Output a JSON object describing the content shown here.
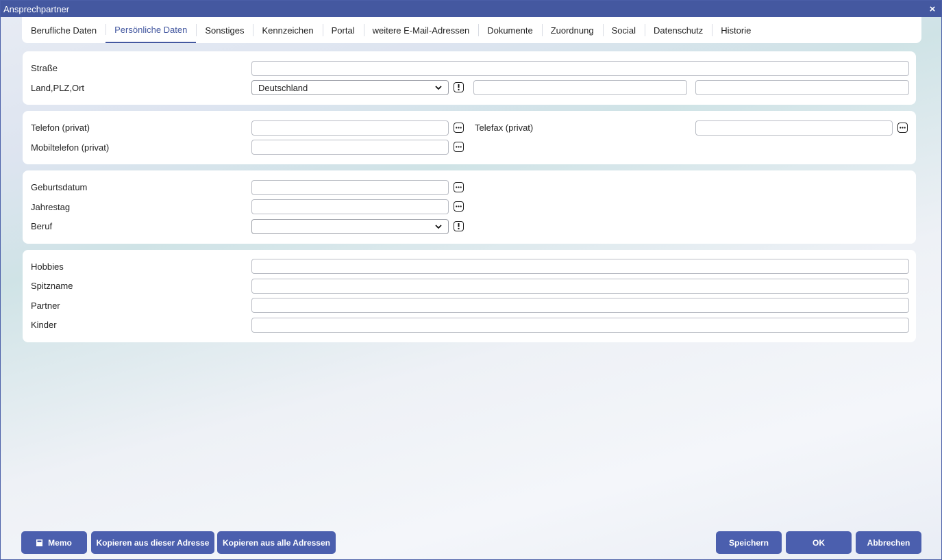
{
  "window": {
    "title": "Ansprechpartner",
    "close_label": "×"
  },
  "tabs": [
    {
      "label": "Berufliche Daten"
    },
    {
      "label": "Persönliche Daten"
    },
    {
      "label": "Sonstiges"
    },
    {
      "label": "Kennzeichen"
    },
    {
      "label": "Portal"
    },
    {
      "label": "weitere E-Mail-Adressen"
    },
    {
      "label": "Dokumente"
    },
    {
      "label": "Zuordnung"
    },
    {
      "label": "Social"
    },
    {
      "label": "Datenschutz"
    },
    {
      "label": "Historie"
    }
  ],
  "active_tab": "Persönliche Daten",
  "address": {
    "strasse_label": "Straße",
    "strasse_value": "",
    "land_label": "Land,PLZ,Ort",
    "land_value": "Deutschland",
    "plz_value": "",
    "ort_value": ""
  },
  "phone": {
    "telefon_label": "Telefon (privat)",
    "telefon_value": "",
    "telefax_label": "Telefax (privat)",
    "telefax_value": "",
    "mobil_label": "Mobiltelefon (privat)",
    "mobil_value": ""
  },
  "personal": {
    "geburtsdatum_label": "Geburtsdatum",
    "geburtsdatum_value": "",
    "jahrestag_label": "Jahrestag",
    "jahrestag_value": "",
    "beruf_label": "Beruf",
    "beruf_value": ""
  },
  "misc": {
    "hobbies_label": "Hobbies",
    "hobbies_value": "",
    "spitzname_label": "Spitzname",
    "spitzname_value": "",
    "partner_label": "Partner",
    "partner_value": "",
    "kinder_label": "Kinder",
    "kinder_value": ""
  },
  "footer": {
    "memo_label": "Memo",
    "copy_this_label": "Kopieren aus dieser Adresse",
    "copy_all_label": "Kopieren aus alle Adressen",
    "save_label": "Speichern",
    "ok_label": "OK",
    "cancel_label": "Abbrechen"
  },
  "icons": {
    "more": "more-dots-icon",
    "warning": "exclamation-icon",
    "memo": "memo-icon",
    "close": "close-icon",
    "chevron": "chevron-down-icon"
  },
  "colors": {
    "accent": "#4458a0",
    "button": "#4b5fae"
  }
}
